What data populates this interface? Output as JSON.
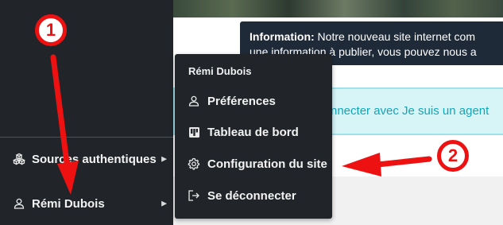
{
  "info_banner": {
    "label": "Information:",
    "line1": "Notre nouveau site internet com",
    "line2": "une information à publier, vous pouvez nous a"
  },
  "connect_banner": {
    "text": "nnecter avec Je suis un agent"
  },
  "sidebar": {
    "items": [
      {
        "label": "Sources authentiques",
        "icon": "cubes-icon"
      },
      {
        "label": "Rémi Dubois",
        "icon": "user-icon"
      }
    ]
  },
  "menu": {
    "title": "Rémi Dubois",
    "items": [
      {
        "label": "Préférences",
        "icon": "user-icon"
      },
      {
        "label": "Tableau de bord",
        "icon": "dashboard-icon"
      },
      {
        "label": "Configuration du site",
        "icon": "gear-icon"
      },
      {
        "label": "Se déconnecter",
        "icon": "logout-icon"
      }
    ]
  },
  "annotations": {
    "badge1": "1",
    "badge2": "2",
    "color": "#ee1111"
  },
  "colors": {
    "sidebar_bg": "#212529",
    "info_bg": "#1f2a38",
    "connect_bg": "#d7f4f7",
    "connect_text": "#10a6b8"
  }
}
